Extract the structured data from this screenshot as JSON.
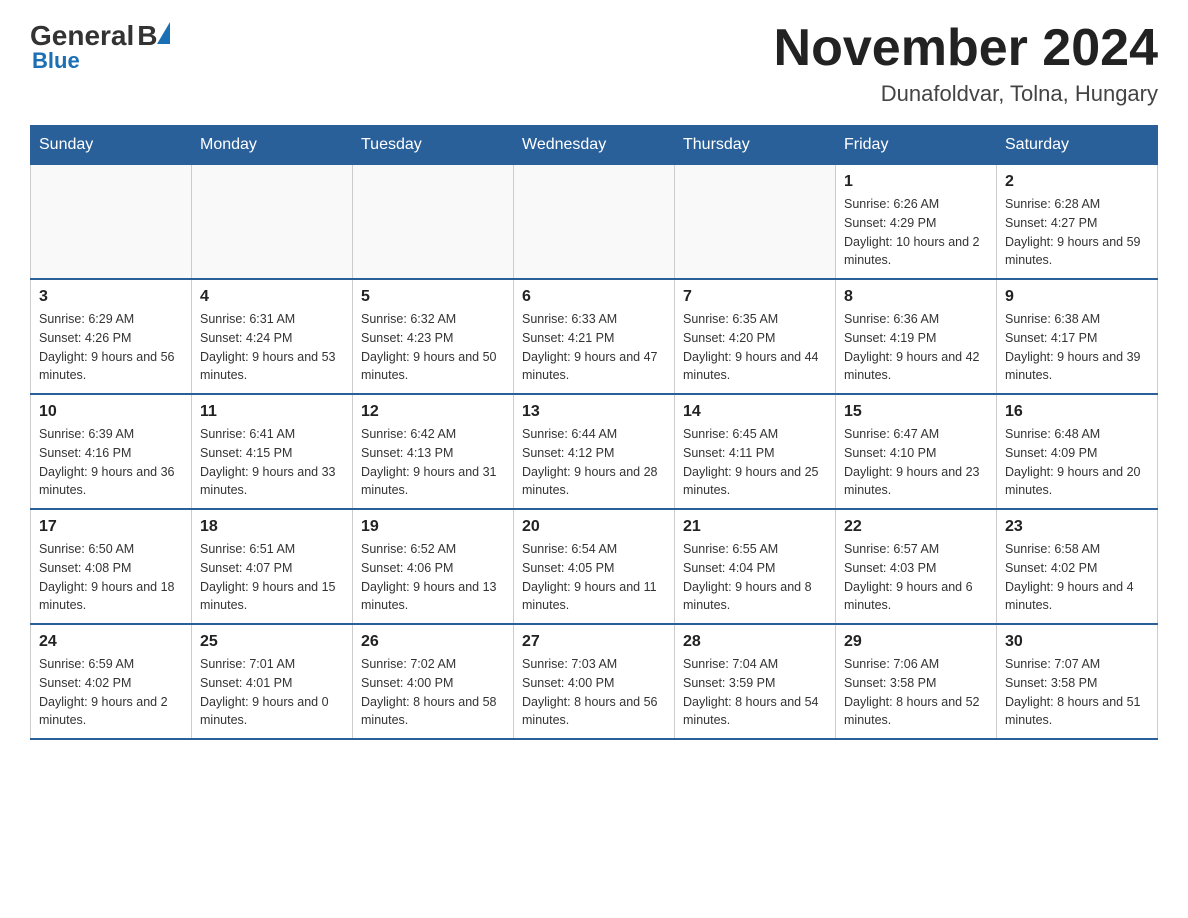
{
  "logo": {
    "general": "General",
    "blue_word": "Blue",
    "triangle_symbol": "▲"
  },
  "title": {
    "month_year": "November 2024",
    "location": "Dunafoldvar, Tolna, Hungary"
  },
  "weekdays": [
    "Sunday",
    "Monday",
    "Tuesday",
    "Wednesday",
    "Thursday",
    "Friday",
    "Saturday"
  ],
  "weeks": [
    [
      {
        "day": "",
        "info": ""
      },
      {
        "day": "",
        "info": ""
      },
      {
        "day": "",
        "info": ""
      },
      {
        "day": "",
        "info": ""
      },
      {
        "day": "",
        "info": ""
      },
      {
        "day": "1",
        "info": "Sunrise: 6:26 AM\nSunset: 4:29 PM\nDaylight: 10 hours and 2 minutes."
      },
      {
        "day": "2",
        "info": "Sunrise: 6:28 AM\nSunset: 4:27 PM\nDaylight: 9 hours and 59 minutes."
      }
    ],
    [
      {
        "day": "3",
        "info": "Sunrise: 6:29 AM\nSunset: 4:26 PM\nDaylight: 9 hours and 56 minutes."
      },
      {
        "day": "4",
        "info": "Sunrise: 6:31 AM\nSunset: 4:24 PM\nDaylight: 9 hours and 53 minutes."
      },
      {
        "day": "5",
        "info": "Sunrise: 6:32 AM\nSunset: 4:23 PM\nDaylight: 9 hours and 50 minutes."
      },
      {
        "day": "6",
        "info": "Sunrise: 6:33 AM\nSunset: 4:21 PM\nDaylight: 9 hours and 47 minutes."
      },
      {
        "day": "7",
        "info": "Sunrise: 6:35 AM\nSunset: 4:20 PM\nDaylight: 9 hours and 44 minutes."
      },
      {
        "day": "8",
        "info": "Sunrise: 6:36 AM\nSunset: 4:19 PM\nDaylight: 9 hours and 42 minutes."
      },
      {
        "day": "9",
        "info": "Sunrise: 6:38 AM\nSunset: 4:17 PM\nDaylight: 9 hours and 39 minutes."
      }
    ],
    [
      {
        "day": "10",
        "info": "Sunrise: 6:39 AM\nSunset: 4:16 PM\nDaylight: 9 hours and 36 minutes."
      },
      {
        "day": "11",
        "info": "Sunrise: 6:41 AM\nSunset: 4:15 PM\nDaylight: 9 hours and 33 minutes."
      },
      {
        "day": "12",
        "info": "Sunrise: 6:42 AM\nSunset: 4:13 PM\nDaylight: 9 hours and 31 minutes."
      },
      {
        "day": "13",
        "info": "Sunrise: 6:44 AM\nSunset: 4:12 PM\nDaylight: 9 hours and 28 minutes."
      },
      {
        "day": "14",
        "info": "Sunrise: 6:45 AM\nSunset: 4:11 PM\nDaylight: 9 hours and 25 minutes."
      },
      {
        "day": "15",
        "info": "Sunrise: 6:47 AM\nSunset: 4:10 PM\nDaylight: 9 hours and 23 minutes."
      },
      {
        "day": "16",
        "info": "Sunrise: 6:48 AM\nSunset: 4:09 PM\nDaylight: 9 hours and 20 minutes."
      }
    ],
    [
      {
        "day": "17",
        "info": "Sunrise: 6:50 AM\nSunset: 4:08 PM\nDaylight: 9 hours and 18 minutes."
      },
      {
        "day": "18",
        "info": "Sunrise: 6:51 AM\nSunset: 4:07 PM\nDaylight: 9 hours and 15 minutes."
      },
      {
        "day": "19",
        "info": "Sunrise: 6:52 AM\nSunset: 4:06 PM\nDaylight: 9 hours and 13 minutes."
      },
      {
        "day": "20",
        "info": "Sunrise: 6:54 AM\nSunset: 4:05 PM\nDaylight: 9 hours and 11 minutes."
      },
      {
        "day": "21",
        "info": "Sunrise: 6:55 AM\nSunset: 4:04 PM\nDaylight: 9 hours and 8 minutes."
      },
      {
        "day": "22",
        "info": "Sunrise: 6:57 AM\nSunset: 4:03 PM\nDaylight: 9 hours and 6 minutes."
      },
      {
        "day": "23",
        "info": "Sunrise: 6:58 AM\nSunset: 4:02 PM\nDaylight: 9 hours and 4 minutes."
      }
    ],
    [
      {
        "day": "24",
        "info": "Sunrise: 6:59 AM\nSunset: 4:02 PM\nDaylight: 9 hours and 2 minutes."
      },
      {
        "day": "25",
        "info": "Sunrise: 7:01 AM\nSunset: 4:01 PM\nDaylight: 9 hours and 0 minutes."
      },
      {
        "day": "26",
        "info": "Sunrise: 7:02 AM\nSunset: 4:00 PM\nDaylight: 8 hours and 58 minutes."
      },
      {
        "day": "27",
        "info": "Sunrise: 7:03 AM\nSunset: 4:00 PM\nDaylight: 8 hours and 56 minutes."
      },
      {
        "day": "28",
        "info": "Sunrise: 7:04 AM\nSunset: 3:59 PM\nDaylight: 8 hours and 54 minutes."
      },
      {
        "day": "29",
        "info": "Sunrise: 7:06 AM\nSunset: 3:58 PM\nDaylight: 8 hours and 52 minutes."
      },
      {
        "day": "30",
        "info": "Sunrise: 7:07 AM\nSunset: 3:58 PM\nDaylight: 8 hours and 51 minutes."
      }
    ]
  ]
}
